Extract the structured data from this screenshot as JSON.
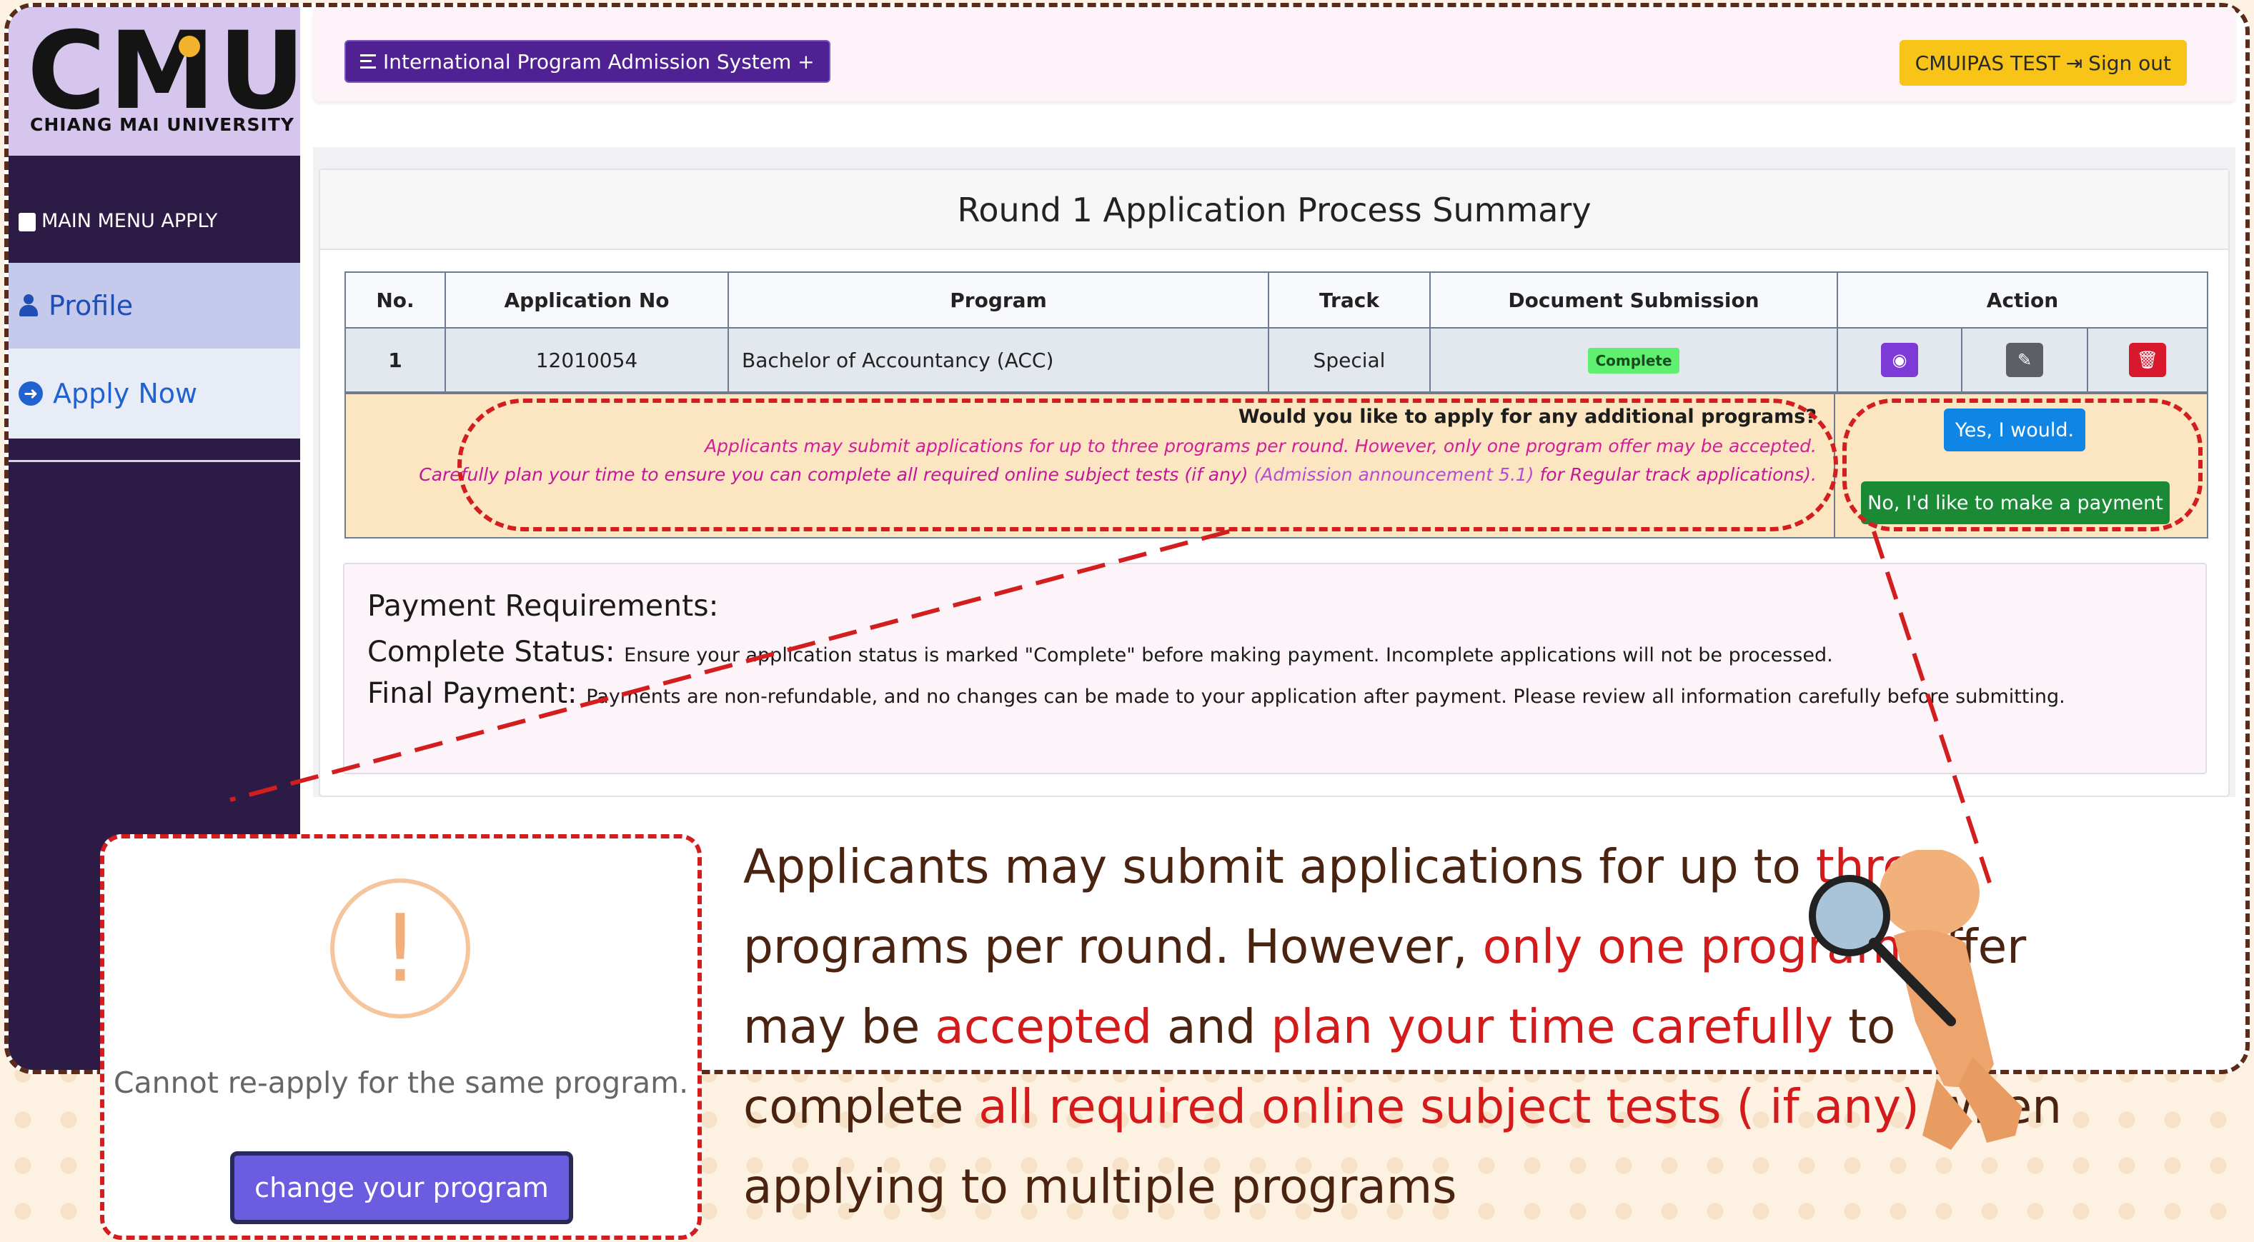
{
  "brand": {
    "logo_text": "CMU",
    "university": "CHIANG MAI UNIVERSITY"
  },
  "sidebar": {
    "title": "MAIN MENU APPLY",
    "items": [
      {
        "label": "Profile",
        "icon": "person-icon"
      },
      {
        "label": "Apply Now",
        "icon": "arrow-circle-icon"
      }
    ]
  },
  "topbar": {
    "system_button": "International Program Admission System +",
    "signout": "CMUIPAS TEST",
    "signout_label": "Sign out"
  },
  "summary": {
    "title": "Round 1 Application Process Summary",
    "columns": [
      "No.",
      "Application No",
      "Program",
      "Track",
      "Document Submission",
      "Action"
    ],
    "rows": [
      {
        "no": "1",
        "application_no": "12010054",
        "program": "Bachelor of Accountancy (ACC)",
        "track": "Special",
        "document_status": "Complete"
      }
    ]
  },
  "additional": {
    "question": "Would you like to apply for any additional programs?",
    "note1": "Applicants may submit applications for up to three programs per round. However, only one program offer may be accepted.",
    "note2_prefix": "Carefully plan your time to ensure you can complete all required online subject tests (if any) ",
    "note2_link": "(Admission announcement 5.1)",
    "note2_suffix": " for Regular track applications).",
    "yes_label": "Yes, I would.",
    "no_label": "No, I'd like to make a payment"
  },
  "payment": {
    "heading": "Payment Requirements:",
    "complete_label": "Complete Status:",
    "complete_text": "Ensure your application status is marked \"Complete\" before making payment. Incomplete applications will not be processed.",
    "final_label": "Final Payment:",
    "final_text": "Payments are non-refundable, and no changes can be made to your application after payment. Please review all information carefully before submitting."
  },
  "popup": {
    "message": "Cannot re-apply for the same program.",
    "button": "change your program"
  },
  "caption": {
    "p1": "Applicants may submit applications for up to ",
    "h1": "three",
    "p2": " programs per round. However, ",
    "h2": "only one program",
    "p3": " offer may be ",
    "h3": "accepted",
    "p4": " and ",
    "h4": "plan your time carefully",
    "p5": " to complete ",
    "h5": "all required online subject tests ( if any)",
    "p6": " when applying to multiple programs"
  },
  "colors": {
    "sidebar": "#2c1b45",
    "accent_purple": "#4f2193",
    "signout_yellow": "#f8c418",
    "highlight_red": "#d31b1b"
  }
}
